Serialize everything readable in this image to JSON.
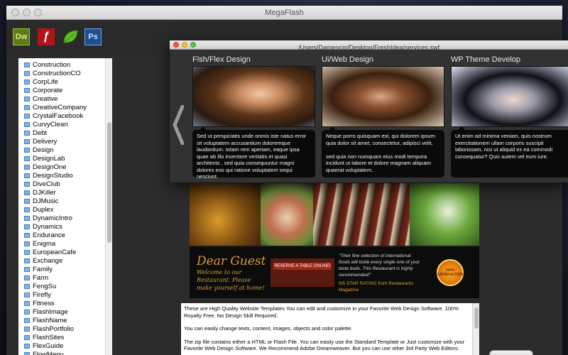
{
  "app": {
    "title": "MegaFlash"
  },
  "toolbar": {
    "icons": [
      {
        "name": "dreamweaver-icon",
        "label": "Dw"
      },
      {
        "name": "flash-icon",
        "label": "ƒ"
      },
      {
        "name": "leaf-icon",
        "label": ""
      },
      {
        "name": "photoshop-icon",
        "label": "Ps"
      }
    ]
  },
  "sidebar": {
    "items": [
      "Construction",
      "ConstructionCO",
      "CorpLife",
      "Corporate",
      "Creative",
      "CreativeCompany",
      "CrystalFacebook",
      "CurvyClean",
      "Debt",
      "Delivery",
      "Design",
      "DesignLab",
      "DesignOne",
      "DesignStudio",
      "DiveClub",
      "DJKiller",
      "DJMusic",
      "Duplex",
      "DynamicIntro",
      "Dynamics",
      "Endurance",
      "Enigma",
      "EuropeanCafe",
      "Exchange",
      "Family",
      "Farm",
      "FengSu",
      "Firefly",
      "Fitness",
      "FlashImage",
      "FlashName",
      "FlashPortfolio",
      "FlashSites",
      "FlexGuide",
      "FlowMenu"
    ]
  },
  "swf_window": {
    "title": "/Users/Damencio/Desktop/FreshIdea/services.swf",
    "cards": [
      {
        "title": "Flsh/Flex Design",
        "desc": "Sed ut perspiciatis unde omnis iste natus error sit voluptatem accusantium doloremque laudantium. totam rem aperiam, eaque ipsa quae ab illo inventore veritatis et quasi architecto , sed quia consequuntur magni dolores eos qui ratione voluptatem sequi nesciunt."
      },
      {
        "title": "Ui/Web Design",
        "desc": "Neque porro quisquam est, qui dolorem ipsum quia dolor sit amet, consectetur, adipisci velit,\n\n sed quia non numquam eius modi tempora incidunt ut labore et dolore magnam aliquam quaerat voluptatem."
      },
      {
        "title": "WP Theme Develop",
        "desc": "Ut enim ad minima veniam, quis nostrum exercitationem ullam corporis suscipit laboriosam, nisi ut aliquid ex ea commodi consequatur? Quis autem vel eum iure."
      }
    ]
  },
  "preview": {
    "guest_title": "Dear Guest",
    "guest_sub": "Welcome to our Restaurant. Please make yourself at home!",
    "reserve_label": "RESERVE A TABLE ONLINE!",
    "quote": "\"Their fine selection of international foods will tickle every single one of your taste buds. This Restaurant is highly recommended!\"",
    "quote_meta": "5/5 STAR RATING from Restaurants Magazine",
    "seal_text": "100% SATISFACTION"
  },
  "description": {
    "paragraphs": [
      "These are High Quality Website Templates You can edit and customize in your Favorite Web Design Software. 100% Royalty Free. No Design Skill Required.",
      "You can easily change texts, content, images, objects and color palette.",
      "The zip file contains either a HTML or Flash File. You can easily use the Standard Template or Just customize with your Favorite Web Design Software. We Recommend Adobe Dreamweaver. But you can use other 3rd Party Web Editors."
    ]
  }
}
